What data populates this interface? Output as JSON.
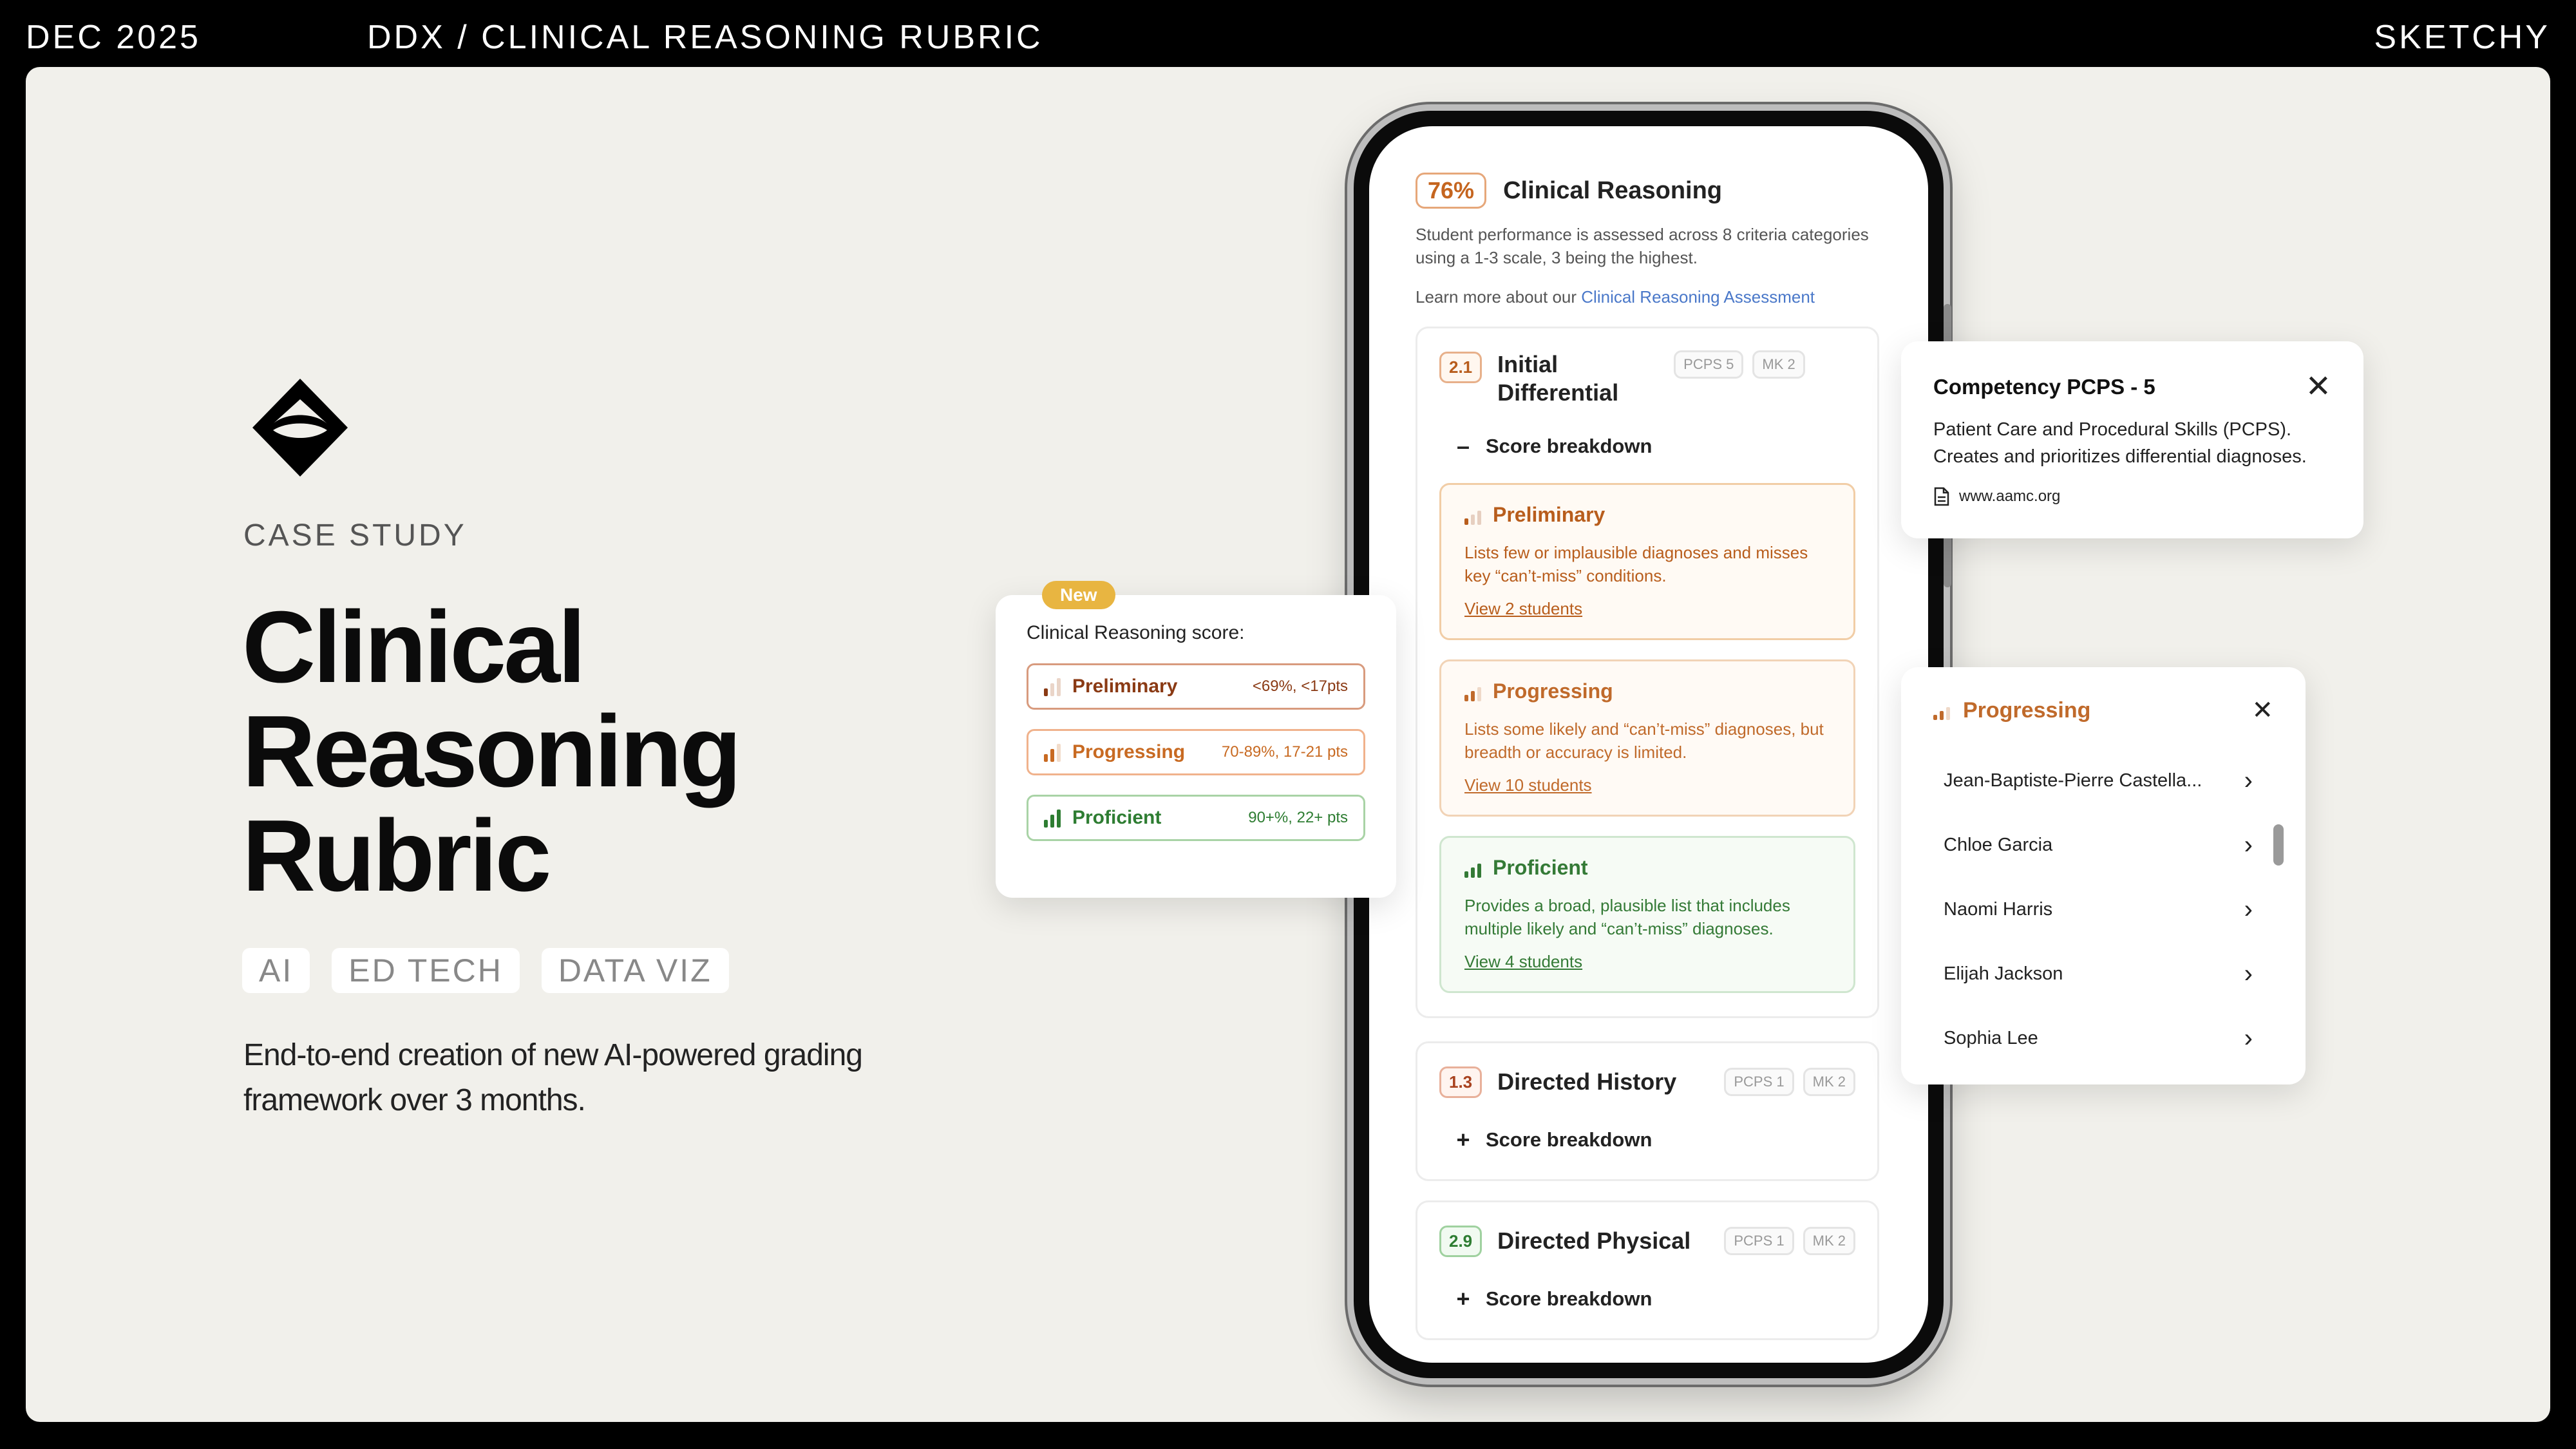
{
  "topbar": {
    "date": "DEC 2025",
    "path": "DDX / CLINICAL REASONING RUBRIC",
    "brand": "SKETCHY"
  },
  "hero": {
    "eyebrow": "CASE STUDY",
    "title_lines": [
      "Clinical",
      "Reasoning",
      "Rubric"
    ],
    "tags": [
      "AI",
      "ED TECH",
      "DATA VIZ"
    ],
    "description": "End-to-end creation of new AI-powered grading framework over 3 months."
  },
  "phone": {
    "percent": "76%",
    "title": "Clinical Reasoning",
    "description": "Student performance is assessed across 8 criteria categories using a 1-3 scale, 3 being the highest.",
    "learn_prefix": "Learn more about our ",
    "learn_link": "Clinical Reasoning Assessment",
    "criteria": [
      {
        "num": "2.1",
        "title": "Initial Differential",
        "chips": [
          "PCPS 5",
          "MK 2"
        ],
        "breakdown_label": "Score breakdown",
        "expanded": true
      },
      {
        "num": "1.3",
        "title": "Directed History",
        "chips": [
          "PCPS 1",
          "MK 2"
        ],
        "breakdown_label": "Score breakdown",
        "expanded": false
      },
      {
        "num": "2.9",
        "title": "Directed Physical",
        "chips": [
          "PCPS 1",
          "MK 2"
        ],
        "breakdown_label": "Score breakdown",
        "expanded": false
      }
    ],
    "levels": [
      {
        "title": "Preliminary",
        "desc": "Lists few or implausible diagnoses and misses key “can’t-miss” conditions.",
        "link": "View 2 students",
        "bars_filled": 1
      },
      {
        "title": "Progressing",
        "desc": "Lists some likely and “can’t-miss” diagnoses, but breadth or accuracy is limited.",
        "link": "View 10 students",
        "bars_filled": 2
      },
      {
        "title": "Proficient",
        "desc": "Provides a broad, plausible list that includes multiple likely and “can’t-miss” diagnoses.",
        "link": "View 4 students",
        "bars_filled": 3
      }
    ]
  },
  "score_card": {
    "badge": "New",
    "title": "Clinical Reasoning score:",
    "rows": [
      {
        "label": "Preliminary",
        "range": "<69%, <17pts",
        "bars_filled": 1
      },
      {
        "label": "Progressing",
        "range": "70-89%, 17-21 pts",
        "bars_filled": 2
      },
      {
        "label": "Proficient",
        "range": "90+%, 22+ pts",
        "bars_filled": 3
      }
    ]
  },
  "competency_card": {
    "title": "Competency PCPS - 5",
    "desc": "Patient Care and Procedural Skills (PCPS). Creates and prioritizes differential diagnoses.",
    "link": "www.aamc.org",
    "icon": "document-icon"
  },
  "progressing_card": {
    "title": "Progressing",
    "students": [
      "Jean-Baptiste-Pierre Castella...",
      "Chloe Garcia",
      "Naomi Harris",
      "Elijah Jackson",
      "Sophia Lee"
    ]
  },
  "colors": {
    "preliminary": "#a8421f",
    "progressing": "#c86a22",
    "proficient": "#2e7d32",
    "canvas": "#f1f0eb",
    "new_badge": "#e8b541",
    "link_blue": "#4a78c9"
  }
}
